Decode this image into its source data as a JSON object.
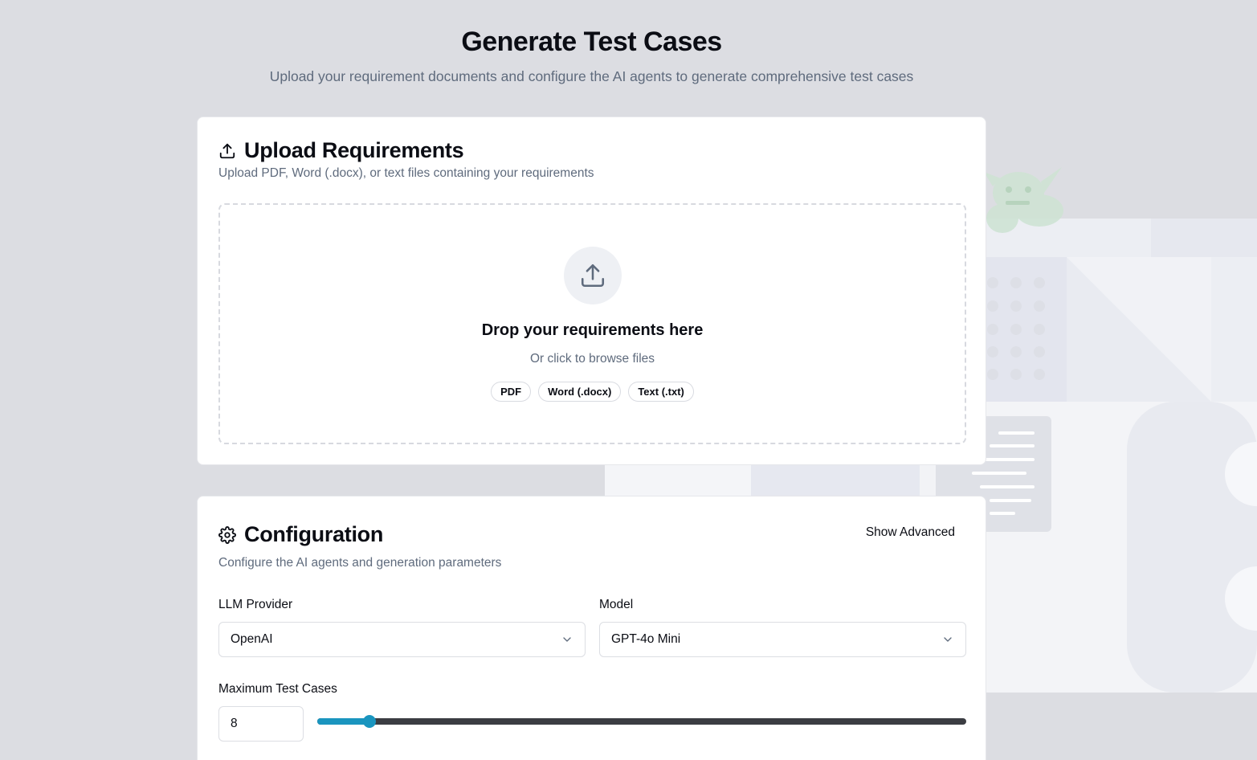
{
  "header": {
    "title": "Generate Test Cases",
    "subtitle": "Upload your requirement documents and configure the AI agents to generate comprehensive test cases"
  },
  "upload": {
    "icon": "upload-icon",
    "title": "Upload Requirements",
    "description": "Upload PDF, Word (.docx), or text files containing your requirements",
    "dropzone": {
      "icon": "upload-icon",
      "title": "Drop your requirements here",
      "subtitle": "Or click to browse files",
      "formats": [
        "PDF",
        "Word (.docx)",
        "Text (.txt)"
      ]
    }
  },
  "config": {
    "icon": "gear-icon",
    "title": "Configuration",
    "description": "Configure the AI agents and generation parameters",
    "show_advanced_label": "Show Advanced",
    "llm_provider": {
      "label": "LLM Provider",
      "value": "OpenAI"
    },
    "model": {
      "label": "Model",
      "value": "GPT-4o Mini"
    },
    "max_test_cases": {
      "label": "Maximum Test Cases",
      "value": "8",
      "slider_fraction": 0.08
    }
  },
  "colors": {
    "background": "#dcdde2",
    "accent": "#1a95bf",
    "text_primary": "#0b0d14",
    "text_muted": "#5f6b7d"
  }
}
